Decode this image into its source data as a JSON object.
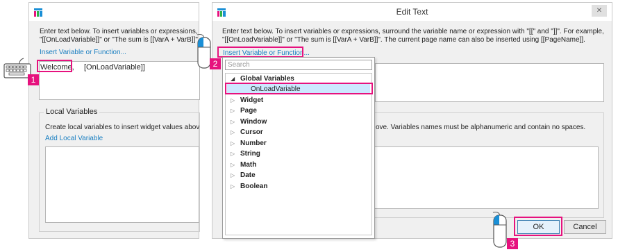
{
  "left_dialog": {
    "instructions_line1": "Enter text below. To insert variables or expressions,",
    "instructions_line2": "\"[[OnLoadVariable]]\" or \"The sum is [[VarA + VarB]]\".",
    "insert_link": "Insert Variable or Function...",
    "text_welcome": "Welcome,",
    "text_variable": "[OnLoadVariable]]",
    "local_vars_title": "Local Variables",
    "local_vars_desc": "Create local variables to insert widget values abov",
    "add_local_link": "Add Local Variable"
  },
  "right_dialog": {
    "title": "Edit Text",
    "close_glyph": "✕",
    "instructions_line1": "Enter text below. To insert variables or expressions, surround the variable name or expression with \"[[\" and \"]]\". For example,",
    "instructions_line2": "\"[[OnLoadVariable]]\" or \"The sum is [[VarA + VarB]]\". The current page name can also be inserted using [[PageName]].",
    "insert_link": "Insert Variable or Function...",
    "local_vars_desc_tail": "ove. Variables names must be alphanumeric and contain no spaces.",
    "ok_label": "OK",
    "cancel_label": "Cancel"
  },
  "dropdown": {
    "search_placeholder": "Search",
    "groups": [
      {
        "label": "Global Variables",
        "expanded": true,
        "children": [
          "OnLoadVariable"
        ]
      },
      {
        "label": "Widget"
      },
      {
        "label": "Page"
      },
      {
        "label": "Window"
      },
      {
        "label": "Cursor"
      },
      {
        "label": "Number"
      },
      {
        "label": "String"
      },
      {
        "label": "Math"
      },
      {
        "label": "Date"
      },
      {
        "label": "Boolean"
      }
    ]
  },
  "steps": [
    "1",
    "2",
    "3"
  ],
  "colors": {
    "accent": "#e6127e",
    "link": "#1a7fc1",
    "selection": "#cce8ff"
  }
}
